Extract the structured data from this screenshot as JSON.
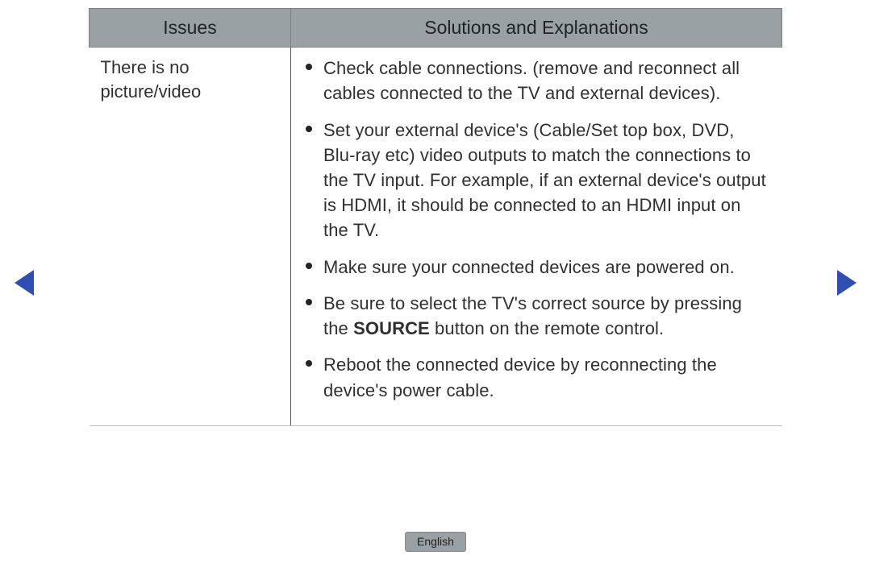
{
  "table": {
    "headers": {
      "col1": "Issues",
      "col2": "Solutions and Explanations"
    },
    "row": {
      "issue": "There is no picture/video",
      "solutions": [
        {
          "text": "Check cable connections. (remove and reconnect all cables connected to the TV and external devices)."
        },
        {
          "text": "Set your external device's (Cable/Set top box, DVD, Blu-ray etc) video outputs to match the connections to the TV input. For example, if an external device's output is HDMI, it should be connected to an HDMI input on the TV."
        },
        {
          "text": "Make sure your connected devices are powered on."
        },
        {
          "pre": "Be sure to select the TV's correct source by pressing the ",
          "bold": "SOURCE",
          "post": " button on the remote control."
        },
        {
          "text": "Reboot the connected device by reconnecting the device's power cable."
        }
      ]
    }
  },
  "footer": {
    "language": "English"
  }
}
